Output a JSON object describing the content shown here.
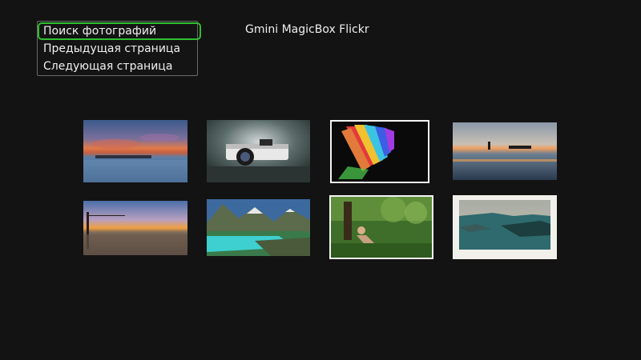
{
  "app": {
    "title": "Gmini MagicBox Flickr"
  },
  "menu": {
    "items": [
      {
        "label": "Поиск фотографий",
        "selected": true
      },
      {
        "label": "Предыдущая страница",
        "selected": false
      },
      {
        "label": "Следующая страница",
        "selected": false
      }
    ]
  },
  "colors": {
    "background": "#131313",
    "selection_border": "#2fbf2f",
    "menu_border": "#6a6a6a",
    "text": "#f0f0f0"
  },
  "gallery": {
    "thumbnails": [
      {
        "subject": "seascape-sunset"
      },
      {
        "subject": "vintage-camera"
      },
      {
        "subject": "colorful-ribbons"
      },
      {
        "subject": "sea-with-boats"
      },
      {
        "subject": "beach-sunset"
      },
      {
        "subject": "mountain-lake"
      },
      {
        "subject": "girl-in-forest"
      },
      {
        "subject": "misty-lake"
      }
    ]
  }
}
